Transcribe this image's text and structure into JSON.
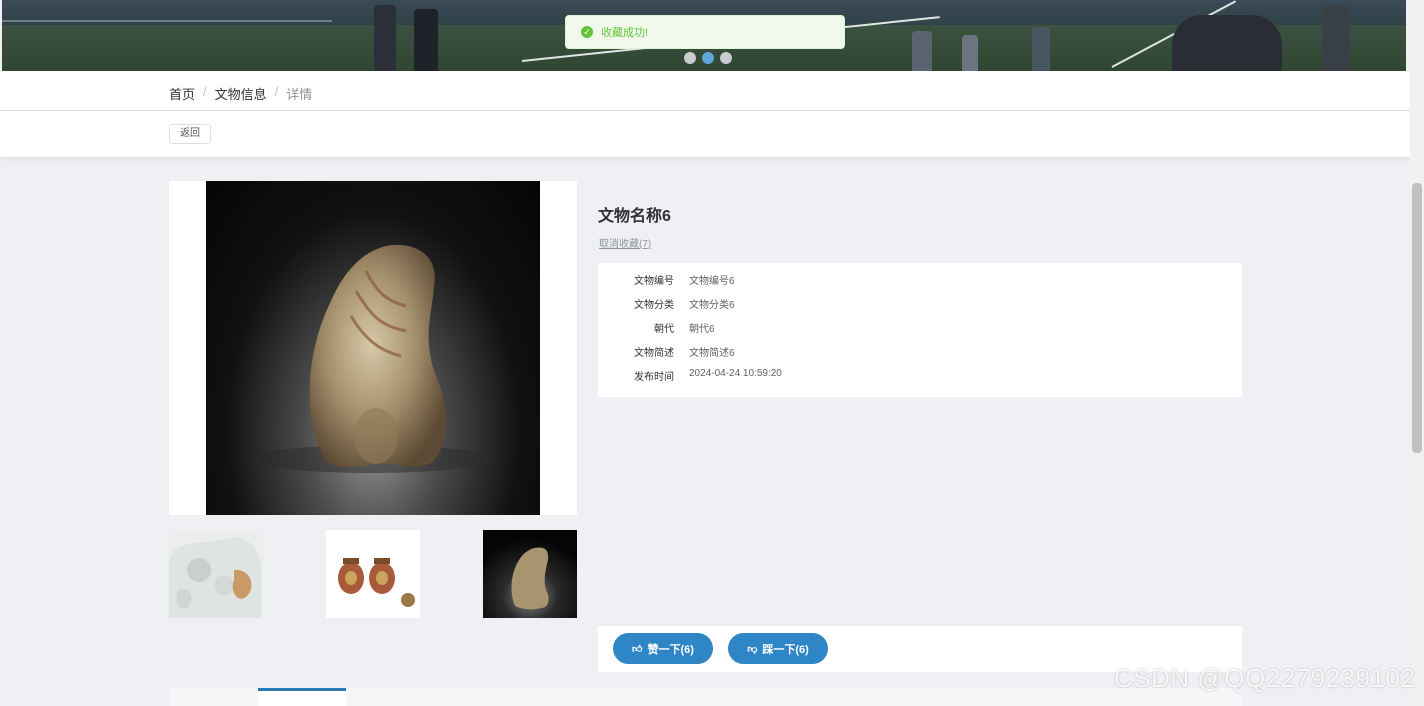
{
  "toast": {
    "message": "收藏成功!"
  },
  "carousel": {
    "active_index": 1,
    "count": 3
  },
  "breadcrumb": {
    "items": [
      "首页",
      "文物信息",
      "详情"
    ]
  },
  "back_button": "返回",
  "artifact": {
    "title": "文物名称6",
    "favorite_link": "取消收藏(7)",
    "fields": [
      {
        "label": "文物编号",
        "value": "文物编号6"
      },
      {
        "label": "文物分类",
        "value": "文物分类6"
      },
      {
        "label": "朝代",
        "value": "朝代6"
      },
      {
        "label": "文物简述",
        "value": "文物简述6"
      },
      {
        "label": "发布时间",
        "value": "2024-04-24 10:59:20"
      }
    ]
  },
  "votes": {
    "like_label": "赞一下(6)",
    "dislike_label": "踩一下(6)"
  },
  "watermark": "CSDN @QQ2279239102",
  "colors": {
    "primary": "#2f86c6",
    "success": "#67c23a",
    "tab_accent": "#2a7ab8"
  }
}
